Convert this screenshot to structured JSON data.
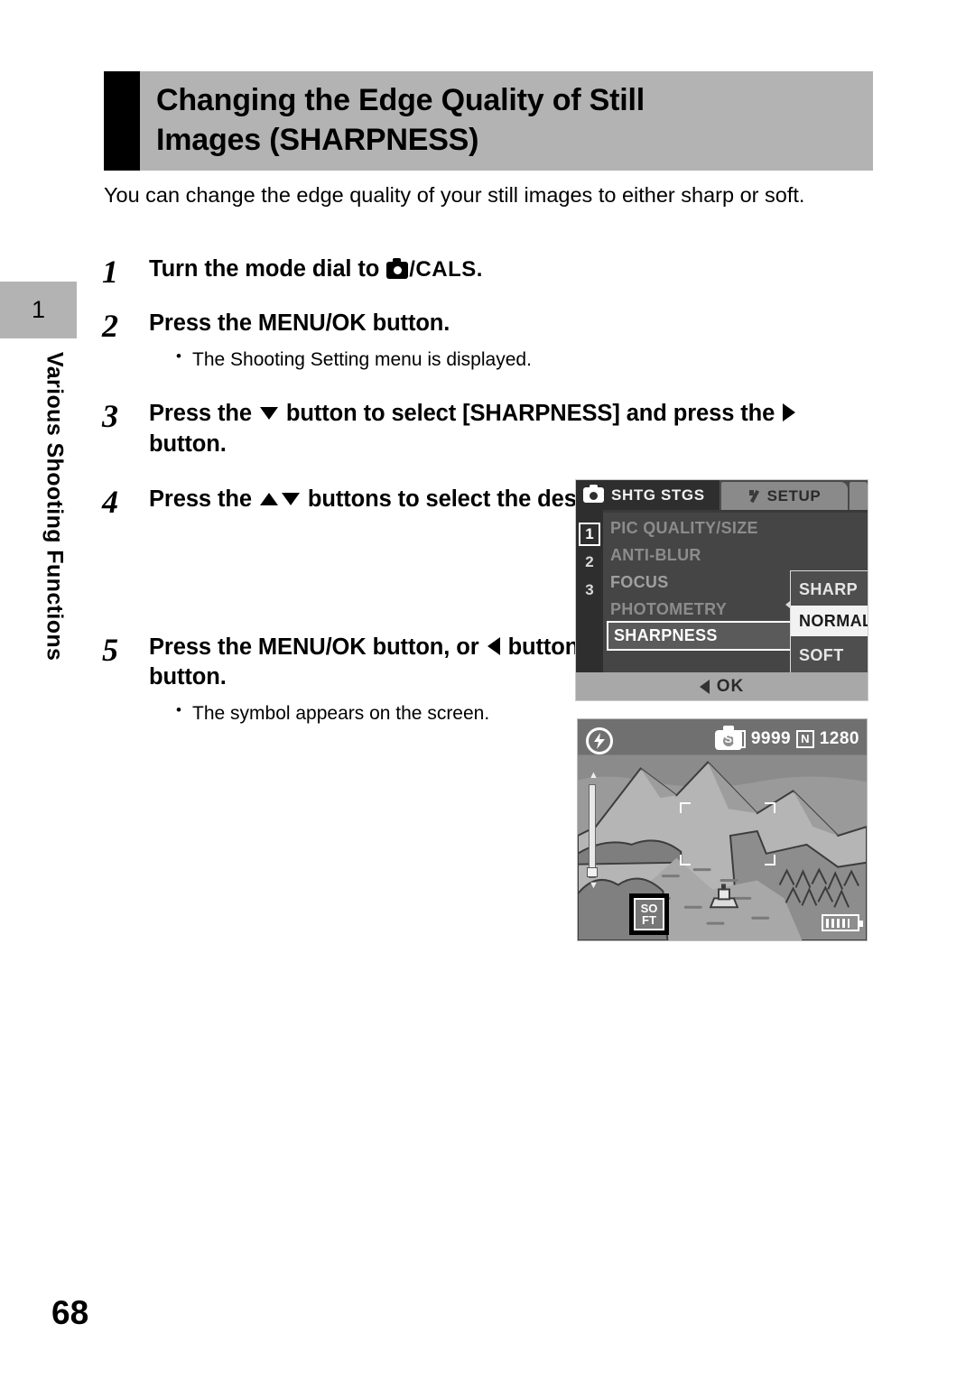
{
  "document": {
    "page_number": "68",
    "chapter_tab_number": "1",
    "chapter_title": "Various Shooting Functions"
  },
  "header": {
    "title_line1": "Changing the Edge Quality of Still",
    "title_line2": "Images (SHARPNESS)"
  },
  "intro": {
    "text": "You can change the edge quality of your still images to either sharp or soft."
  },
  "steps": [
    {
      "number": "1",
      "text_before": "Turn the mode dial to",
      "icon": "camera-mode-icon",
      "text_after": "/CALS."
    },
    {
      "number": "2",
      "text": "Press the MENU/OK button.",
      "note": "The Shooting Setting menu is displayed."
    },
    {
      "number": "3",
      "text_a": "Press the",
      "icon_a": "triangle-down-icon",
      "text_b": "button to select [SHARPNESS] and press the",
      "icon_b": "triangle-right-icon",
      "text_c": "button."
    },
    {
      "number": "4",
      "text_a": "Press the",
      "icon_a": "triangle-up-icon",
      "icon_b": "triangle-down-icon",
      "text_b": "buttons to select the desired setting."
    },
    {
      "number": "5",
      "text_a": "Press the MENU/OK button, or",
      "icon_a": "triangle-left-icon",
      "text_b": "button and press the MENU/ OK button.",
      "note": "The symbol appears on the screen."
    }
  ],
  "lcd_menu": {
    "tab_shooting": "SHTG STGS",
    "tab_setup": "SETUP",
    "page_markers": [
      "1",
      "2",
      "3"
    ],
    "items": [
      "PIC QUALITY/SIZE",
      "ANTI-BLUR",
      "FOCUS",
      "PHOTOMETRY",
      "SHARPNESS"
    ],
    "selected_item": "SHARPNESS",
    "dropdown_options": [
      "SHARP",
      "NORMAL",
      "SOFT"
    ],
    "dropdown_selected": "NORMAL",
    "footer_label": "OK"
  },
  "lcd_live": {
    "flash_symbol": "⚡",
    "card_badge": "SD",
    "shots_remaining": "9999",
    "quality_badge": "N",
    "image_size": "1280",
    "sharpness_symbol_line1": "SO",
    "sharpness_symbol_line2": "FT",
    "zoom_tele": "▲",
    "zoom_wide": "▼"
  },
  "colors": {
    "header_gray": "#b3b3b3",
    "header_black": "#000000",
    "lcd_dark": "#3a3a3a",
    "lcd_highlight": "#f2f2f2"
  }
}
